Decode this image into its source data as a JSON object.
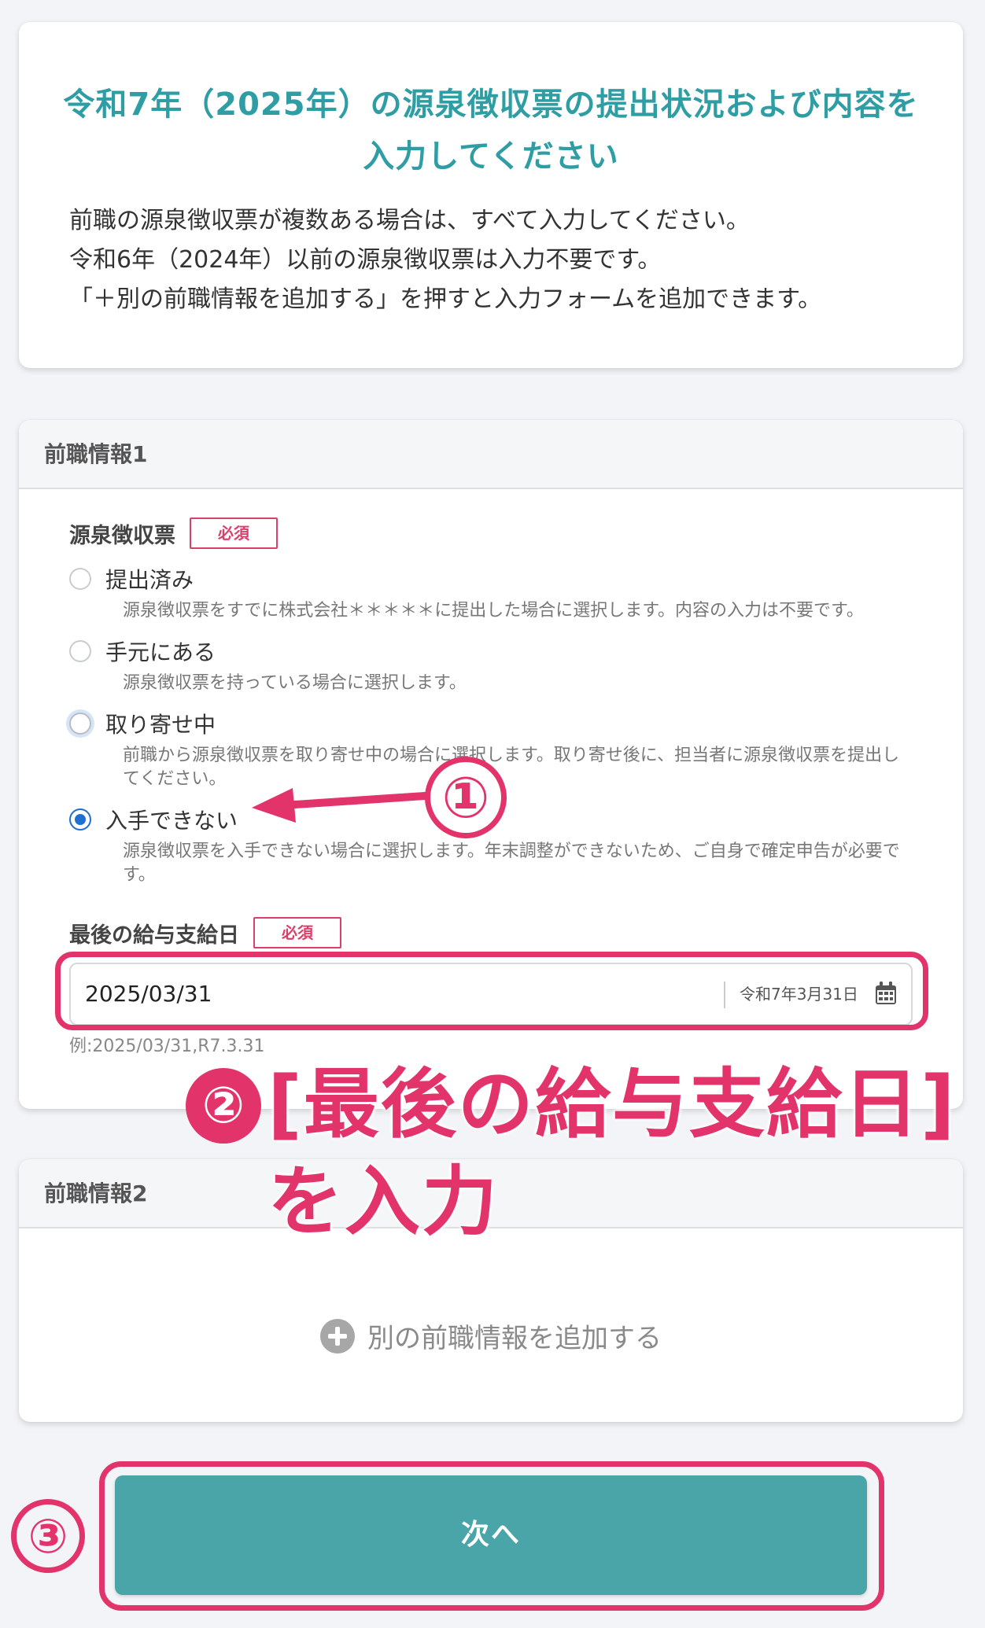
{
  "intro": {
    "title_line1": "令和7年（2025年）の源泉徴収票の提出状況および内容を",
    "title_line2": "入力してください",
    "lines": [
      "前職の源泉徴収票が複数ある場合は、すべて入力してください。",
      "令和6年（2024年）以前の源泉徴収票は入力不要です。",
      "「＋別の前職情報を追加する」を押すと入力フォームを追加できます。"
    ]
  },
  "job1": {
    "header": "前職情報1",
    "withholding": {
      "label": "源泉徴収票",
      "required": "必須",
      "options": [
        {
          "label": "提出済み",
          "desc": "源泉徴収票をすでに株式会社＊＊＊＊＊に提出した場合に選択します。内容の入力は不要です。"
        },
        {
          "label": "手元にある",
          "desc": "源泉徴収票を持っている場合に選択します。"
        },
        {
          "label": "取り寄せ中",
          "desc": "前職から源泉徴収票を取り寄せ中の場合に選択します。取り寄せ後に、担当者に源泉徴収票を提出してください。"
        },
        {
          "label": "入手できない",
          "desc": "源泉徴収票を入手できない場合に選択します。年末調整ができないため、ご自身で確定申告が必要です。"
        }
      ],
      "selected": "入手できない"
    },
    "last_pay_date": {
      "label": "最後の給与支給日",
      "required": "必須",
      "value": "2025/03/31",
      "wareki": "令和7年3月31日",
      "hint": "例:2025/03/31,R7.3.31"
    }
  },
  "job2": {
    "header": "前職情報2",
    "add_label": "別の前職情報を追加する"
  },
  "next_button": "次へ",
  "annotations": {
    "num1": "①",
    "num2": "②",
    "num3": "③",
    "text2_line1": "[最後の給与支給日]",
    "text2_line2": "を入力"
  },
  "colors": {
    "accent": "#2f9ea4",
    "button": "#4aa5a9",
    "required": "#d9416b",
    "annotation": "#e2336b",
    "radio_selected": "#1f6fd0"
  }
}
